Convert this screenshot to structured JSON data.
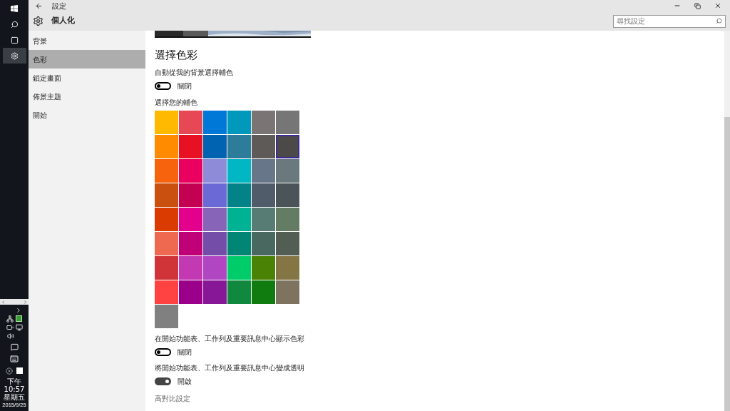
{
  "taskbar": {
    "apps": [
      {
        "kind": "start",
        "selected": false
      },
      {
        "kind": "search",
        "selected": false
      },
      {
        "kind": "taskview",
        "selected": false
      },
      {
        "kind": "settings",
        "selected": true
      }
    ],
    "clock": {
      "time": "下午 10:57",
      "day": "星期五",
      "date": "2015/9/25"
    }
  },
  "window": {
    "title": "設定",
    "section": "個人化",
    "search": {
      "placeholder": "尋找設定"
    }
  },
  "sidebar": {
    "items": [
      {
        "label": "背景",
        "selected": false
      },
      {
        "label": "色彩",
        "selected": true
      },
      {
        "label": "鎖定畫面",
        "selected": false
      },
      {
        "label": "佈景主題",
        "selected": false
      },
      {
        "label": "開始",
        "selected": false
      }
    ]
  },
  "content": {
    "heading": "選擇色彩",
    "auto_color": {
      "label": "自動從我的背景選擇輔色",
      "on": false,
      "state": "關閉"
    },
    "palette_label": "選擇您的輔色",
    "swatches": [
      {
        "color": "#ffb900",
        "selected": false
      },
      {
        "color": "#e74856",
        "selected": false
      },
      {
        "color": "#0078d7",
        "selected": false
      },
      {
        "color": "#0099bc",
        "selected": false
      },
      {
        "color": "#7a7574",
        "selected": false
      },
      {
        "color": "#767676",
        "selected": false
      },
      {
        "color": "#ff8c00",
        "selected": false
      },
      {
        "color": "#e81123",
        "selected": false
      },
      {
        "color": "#0063b1",
        "selected": false
      },
      {
        "color": "#2d7d9a",
        "selected": false
      },
      {
        "color": "#5d5a58",
        "selected": false
      },
      {
        "color": "#4c4a48",
        "selected": true
      },
      {
        "color": "#f7630c",
        "selected": false
      },
      {
        "color": "#ea005e",
        "selected": false
      },
      {
        "color": "#8e8cd8",
        "selected": false
      },
      {
        "color": "#00b7c3",
        "selected": false
      },
      {
        "color": "#68768a",
        "selected": false
      },
      {
        "color": "#69797e",
        "selected": false
      },
      {
        "color": "#ca5010",
        "selected": false
      },
      {
        "color": "#c30052",
        "selected": false
      },
      {
        "color": "#6b69d6",
        "selected": false
      },
      {
        "color": "#038387",
        "selected": false
      },
      {
        "color": "#515c6b",
        "selected": false
      },
      {
        "color": "#4a5459",
        "selected": false
      },
      {
        "color": "#da3b01",
        "selected": false
      },
      {
        "color": "#e3008c",
        "selected": false
      },
      {
        "color": "#8764b8",
        "selected": false
      },
      {
        "color": "#00b294",
        "selected": false
      },
      {
        "color": "#567c73",
        "selected": false
      },
      {
        "color": "#647c64",
        "selected": false
      },
      {
        "color": "#ef6950",
        "selected": false
      },
      {
        "color": "#bf0077",
        "selected": false
      },
      {
        "color": "#744da9",
        "selected": false
      },
      {
        "color": "#018574",
        "selected": false
      },
      {
        "color": "#486860",
        "selected": false
      },
      {
        "color": "#525e54",
        "selected": false
      },
      {
        "color": "#d13438",
        "selected": false
      },
      {
        "color": "#c239b3",
        "selected": false
      },
      {
        "color": "#b146c2",
        "selected": false
      },
      {
        "color": "#00cc6a",
        "selected": false
      },
      {
        "color": "#498205",
        "selected": false
      },
      {
        "color": "#847545",
        "selected": false
      },
      {
        "color": "#ff4343",
        "selected": false
      },
      {
        "color": "#9a0089",
        "selected": false
      },
      {
        "color": "#881798",
        "selected": false
      },
      {
        "color": "#10893e",
        "selected": false
      },
      {
        "color": "#107c10",
        "selected": false
      },
      {
        "color": "#7e735f",
        "selected": false
      },
      {
        "color": "#808080",
        "selected": false
      }
    ],
    "show_color": {
      "label": "在開始功能表、工作列及重要訊息中心顯示色彩",
      "on": false,
      "state": "關閉"
    },
    "transparent": {
      "label": "將開始功能表、工作列及重要訊息中心變成透明",
      "on": true,
      "state": "開啟"
    },
    "link": "高對比設定"
  }
}
